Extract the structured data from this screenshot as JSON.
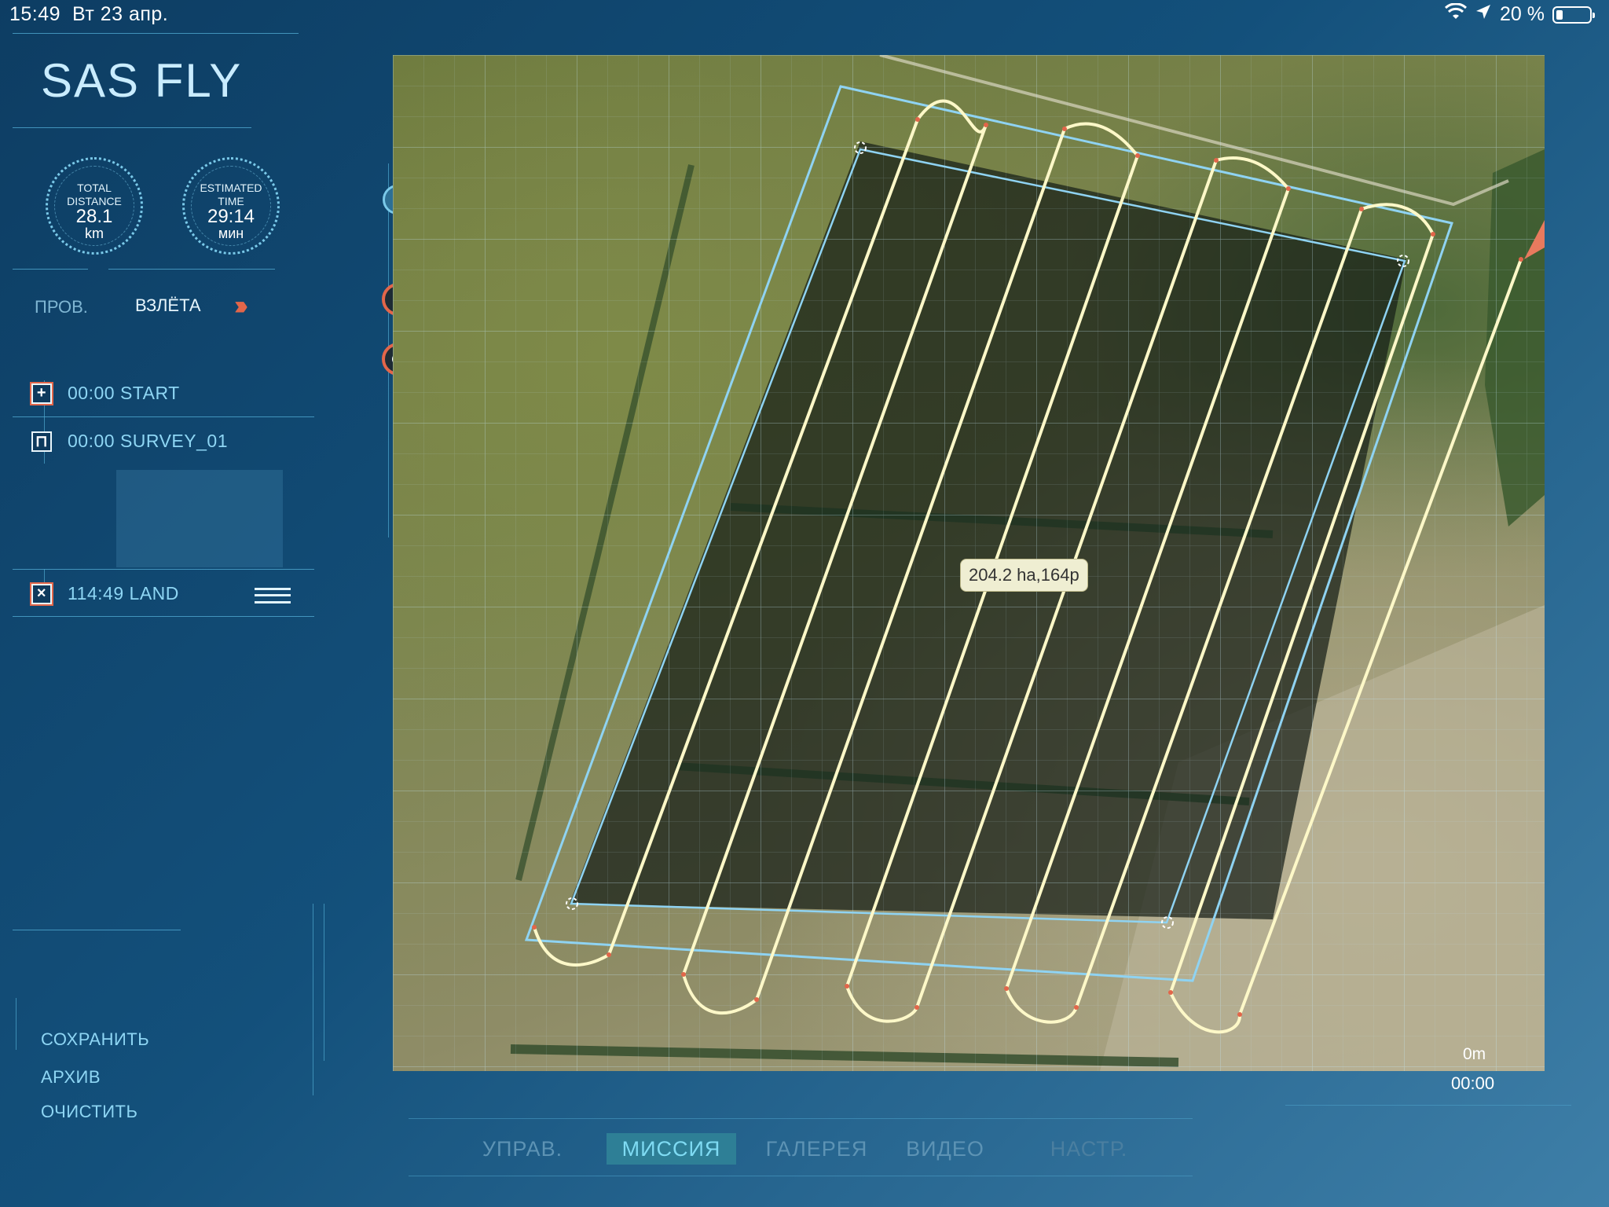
{
  "status_bar": {
    "time": "15:49",
    "date": "Вт 23 апр.",
    "battery": "20 %",
    "battery_level": 0.2
  },
  "app": {
    "title": "SAS FLY"
  },
  "stats": {
    "distance": {
      "label_line1": "TOTAL",
      "label_line2": "DISTANCE",
      "value": "28.1",
      "unit": "km"
    },
    "time": {
      "label_line1": "ESTIMATED",
      "label_line2": "TIME",
      "value": "29:14",
      "unit": "мин"
    }
  },
  "steps": {
    "check": "ПРОВ.",
    "takeoff": "ВЗЛЁТА",
    "chevrons": "›››"
  },
  "mission": [
    {
      "time_label": "00:00 START",
      "icon": "plus-icon",
      "glyph": "+"
    },
    {
      "time_label": "00:00 SURVEY_01",
      "icon": "survey-icon",
      "glyph": "⊓"
    },
    {
      "time_label": "114:49 LAND",
      "icon": "land-icon",
      "glyph": "×"
    }
  ],
  "actions": {
    "save": "СОХРАНИТЬ",
    "archive": "АРХИВ",
    "clear": "ОЧИСТИТЬ"
  },
  "map": {
    "area_label": "204.2 ha,164p",
    "scale_distance": "0m",
    "scale_time": "00:00"
  },
  "tabs": [
    {
      "label": "УПРАВ.",
      "active": false
    },
    {
      "label": "МИССИЯ",
      "active": true
    },
    {
      "label": "ГАЛЕРЕЯ",
      "active": false
    },
    {
      "label": "ВИДЕО",
      "active": false
    },
    {
      "label": "НАСТР.",
      "active": false
    }
  ],
  "colors": {
    "accent": "#e2664a",
    "path": "#fdf8c8",
    "polygon": "#8fd3f2",
    "active_tab": "#2e7f96"
  }
}
